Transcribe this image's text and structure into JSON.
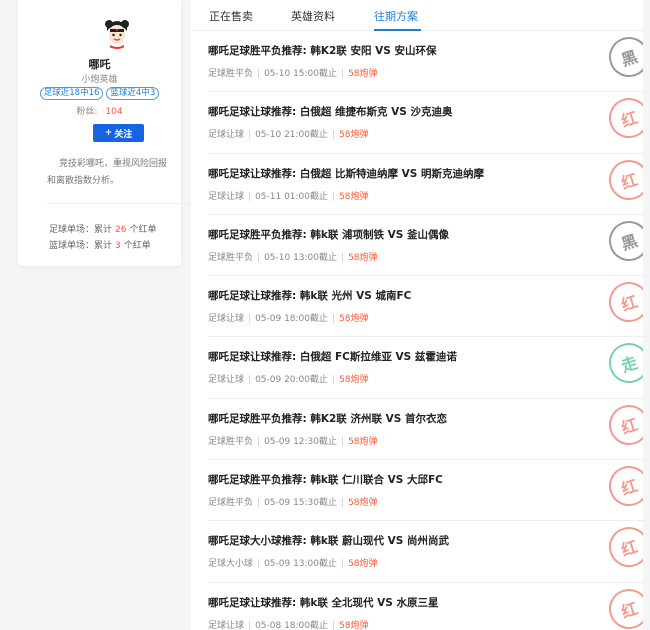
{
  "profile": {
    "name": "哪吒",
    "title": "小炮英雄",
    "tags": [
      "足球近18中16",
      "篮球近4中3"
    ],
    "fans_label": "粉丝:",
    "fans_count": "104",
    "follow_label": "关注",
    "follow_icon": "plus-icon",
    "bio": "竞技彩哪吒，重视风险回报和离散指数分析。",
    "stats": [
      {
        "prefix": "足球单场：累计",
        "count": "26",
        "suffix": "个红单"
      },
      {
        "prefix": "篮球单场：累计",
        "count": "3",
        "suffix": "个红单"
      }
    ]
  },
  "tabs": [
    {
      "label": "正在售卖",
      "active": false
    },
    {
      "label": "英雄资料",
      "active": false
    },
    {
      "label": "往期方案",
      "active": true
    }
  ],
  "items": [
    {
      "title": "哪吒足球胜平负推荐: 韩K2联 安阳 VS 安山环保",
      "category": "足球胜平负",
      "time": "05-10 15:00截止",
      "price": "58炮弹",
      "stamp": "黑",
      "stamp_color": "#777777"
    },
    {
      "title": "哪吒足球让球推荐: 白俄超 维捷布斯克 VS 沙克迪奥",
      "category": "足球让球",
      "time": "05-10 21:00截止",
      "price": "58炮弹",
      "stamp": "红",
      "stamp_color": "#f07a6a"
    },
    {
      "title": "哪吒足球让球推荐: 白俄超 比斯特迪纳摩 VS 明斯克迪纳摩",
      "category": "足球让球",
      "time": "05-11 01:00截止",
      "price": "58炮弹",
      "stamp": "红",
      "stamp_color": "#f07a6a"
    },
    {
      "title": "哪吒足球胜平负推荐: 韩k联 浦项制铁 VS 釜山偶像",
      "category": "足球胜平负",
      "time": "05-10 13:00截止",
      "price": "58炮弹",
      "stamp": "黑",
      "stamp_color": "#777777"
    },
    {
      "title": "哪吒足球让球推荐: 韩k联 光州 VS 城南FC",
      "category": "足球让球",
      "time": "05-09 18:00截止",
      "price": "58炮弹",
      "stamp": "红",
      "stamp_color": "#f07a6a"
    },
    {
      "title": "哪吒足球让球推荐: 白俄超 FC斯拉维亚 VS 兹霍迪诺",
      "category": "足球让球",
      "time": "05-09 20:00截止",
      "price": "58炮弹",
      "stamp": "走",
      "stamp_color": "#4cc28a"
    },
    {
      "title": "哪吒足球胜平负推荐: 韩K2联 济州联 VS 首尔衣恋",
      "category": "足球胜平负",
      "time": "05-09 12:30截止",
      "price": "58炮弹",
      "stamp": "红",
      "stamp_color": "#f07a6a"
    },
    {
      "title": "哪吒足球胜平负推荐: 韩k联 仁川联合 VS 大邱FC",
      "category": "足球胜平负",
      "time": "05-09 15:30截止",
      "price": "58炮弹",
      "stamp": "红",
      "stamp_color": "#f07a6a"
    },
    {
      "title": "哪吒足球大小球推荐: 韩k联 蔚山现代 VS 尚州尚武",
      "category": "足球大小球",
      "time": "05-09 13:00截止",
      "price": "58炮弹",
      "stamp": "红",
      "stamp_color": "#f07a6a"
    },
    {
      "title": "哪吒足球让球推荐: 韩k联 全北现代 VS 水原三星",
      "category": "足球让球",
      "time": "05-08 18:00截止",
      "price": "58炮弹",
      "stamp": "红",
      "stamp_color": "#f07a6a"
    }
  ]
}
